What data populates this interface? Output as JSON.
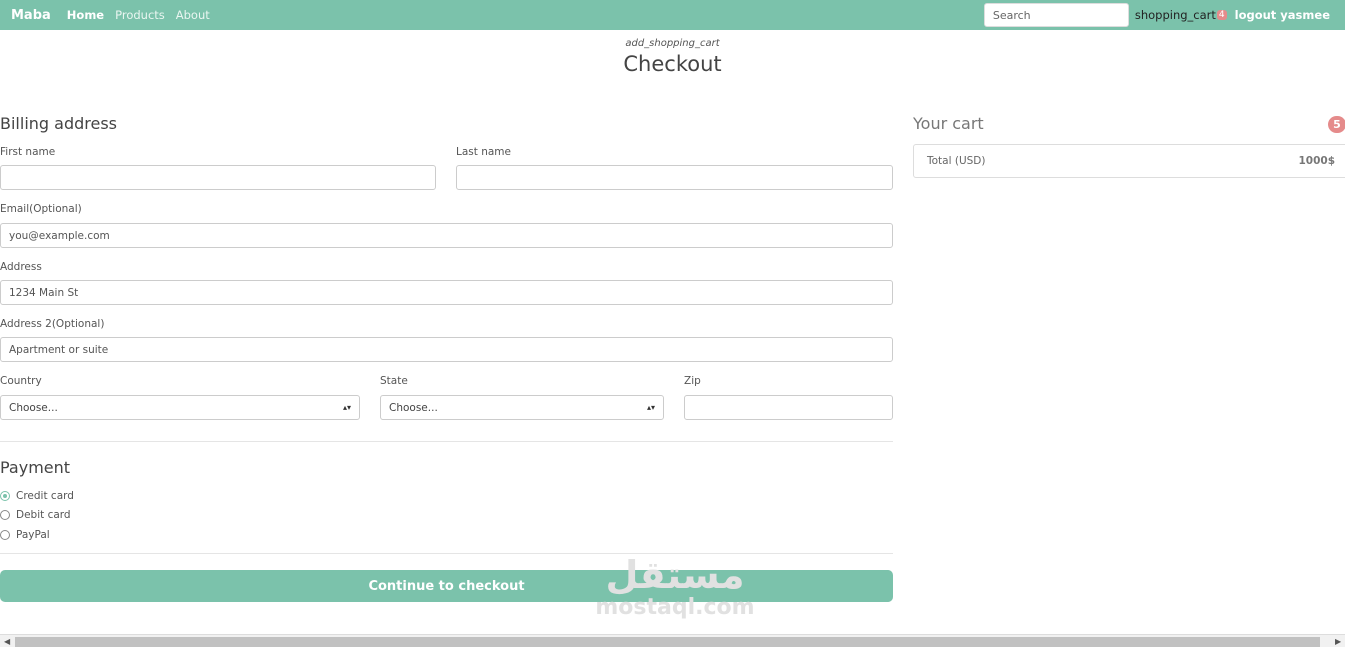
{
  "navbar": {
    "brand": "Maba",
    "links": [
      "Home",
      "Products",
      "About"
    ],
    "search_placeholder": "Search",
    "cart_label": "shopping_cart",
    "cart_count": "4",
    "logout_label": "logout yasmee"
  },
  "header": {
    "icon_text": "add_shopping_cart",
    "title": "Checkout"
  },
  "billing": {
    "title": "Billing address",
    "first_name_label": "First name",
    "last_name_label": "Last name",
    "email_label": "Email(Optional)",
    "email_placeholder": "you@example.com",
    "address_label": "Address",
    "address_placeholder": "1234 Main St",
    "address2_label": "Address 2(Optional)",
    "address2_placeholder": "Apartment or suite",
    "country_label": "Country",
    "country_value": "Choose...",
    "state_label": "State",
    "state_value": "Choose...",
    "zip_label": "Zip"
  },
  "payment": {
    "title": "Payment",
    "options": [
      "Credit card",
      "Debit card",
      "PayPal"
    ],
    "selected": "Credit card"
  },
  "checkout_button": "Continue to checkout",
  "cart": {
    "title": "Your cart",
    "badge": "5",
    "total_label": "Total (USD)",
    "total_value": "1000$"
  },
  "watermark": {
    "arabic": "مستقل",
    "latin": "mostaql.com"
  },
  "colors": {
    "accent": "#7bc2ab",
    "badge": "#e58b8b"
  }
}
